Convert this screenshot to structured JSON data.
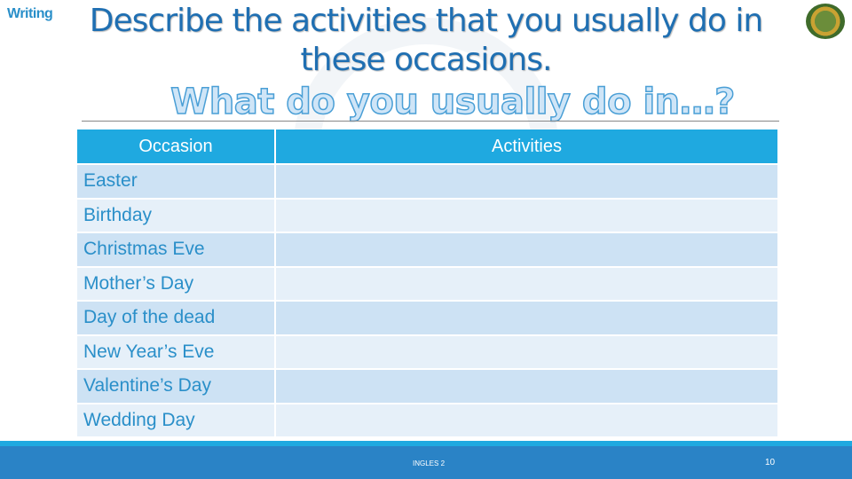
{
  "section_tag": "Writing",
  "title": "Describe the activities that you usually do in these occasions.",
  "subtitle": "What do you usually do in…?",
  "table": {
    "headers": [
      "Occasion",
      "Activities"
    ],
    "rows": [
      {
        "occasion": "Easter",
        "activities": ""
      },
      {
        "occasion": "Birthday",
        "activities": ""
      },
      {
        "occasion": "Christmas Eve",
        "activities": ""
      },
      {
        "occasion": "Mother’s Day",
        "activities": ""
      },
      {
        "occasion": "Day of the dead",
        "activities": ""
      },
      {
        "occasion": "New Year’s Eve",
        "activities": ""
      },
      {
        "occasion": "Valentine’s Day",
        "activities": ""
      },
      {
        "occasion": "Wedding Day",
        "activities": ""
      }
    ]
  },
  "footer": {
    "course": "INGLES 2",
    "page_number": "10"
  },
  "colors": {
    "accent": "#1fa9e0",
    "footer": "#2a83c6",
    "title": "#1f6fb2"
  }
}
